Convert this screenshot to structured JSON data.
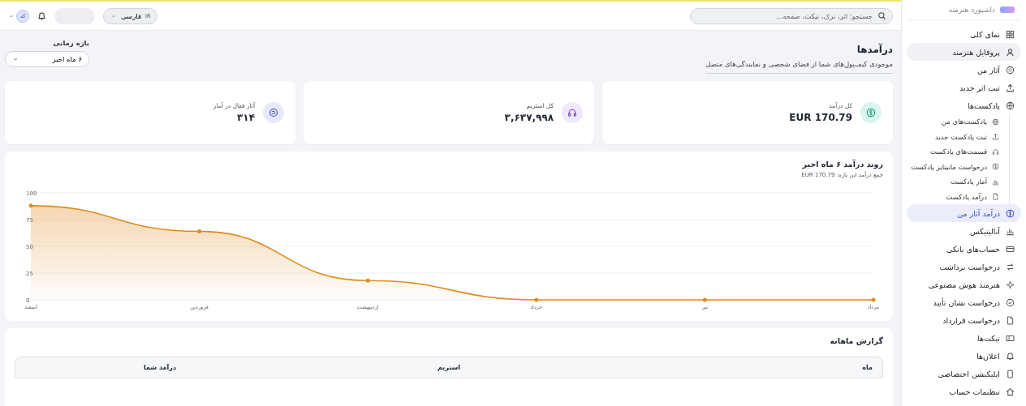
{
  "topbar": {
    "search": {
      "placeholder": "جستجو: اثر، ترک، تیکت، صفحه..."
    },
    "language": {
      "code": "IR",
      "label": "فارسی"
    },
    "avatar": {
      "initials": "که"
    }
  },
  "sidebar": {
    "brand": "داشبورد هنرمند",
    "items": [
      {
        "label": "نمای کلی",
        "selected": false,
        "highlighted": false
      },
      {
        "label": "پروفایل هنرمند",
        "selected": false,
        "highlighted": true
      },
      {
        "label": "آثار من",
        "selected": false,
        "highlighted": false
      },
      {
        "label": "ثبت اثر جدید",
        "selected": false,
        "highlighted": false
      },
      {
        "label": "پادکست‌ها",
        "selected": false,
        "highlighted": false,
        "children": [
          {
            "label": "پادکست‌های من",
            "selected": false
          },
          {
            "label": "ثبت پادکست جدید",
            "selected": false
          },
          {
            "label": "قسمت‌های پادکست",
            "selected": false
          },
          {
            "label": "درخواست مانیتایز پادکست",
            "selected": false
          },
          {
            "label": "آمار پادکست",
            "selected": false
          },
          {
            "label": "درآمد پادکست",
            "selected": false
          }
        ]
      },
      {
        "label": "درآمد آثار من",
        "selected": true,
        "highlighted": false
      },
      {
        "label": "آنالیتیکس",
        "selected": false,
        "highlighted": false
      },
      {
        "label": "حساب‌های بانکی",
        "selected": false,
        "highlighted": false
      },
      {
        "label": "درخواست برداشت",
        "selected": false,
        "highlighted": false
      },
      {
        "label": "هنرمند هوش مصنوعی",
        "selected": false,
        "highlighted": false
      },
      {
        "label": "درخواست نشان تأیید",
        "selected": false,
        "highlighted": false
      },
      {
        "label": "درخواست قرارداد",
        "selected": false,
        "highlighted": false
      },
      {
        "label": "تیکت‌ها",
        "selected": false,
        "highlighted": false
      },
      {
        "label": "اعلان‌ها",
        "selected": false,
        "highlighted": false
      },
      {
        "label": "اپلیکیشن اختصاصی",
        "selected": false,
        "highlighted": false
      },
      {
        "label": "تنظیمات حساب",
        "selected": false,
        "highlighted": false
      }
    ]
  },
  "header": {
    "title": "درآمدها",
    "subtitle": "موجودی کیف‌پول‌های شما از فضای شخصی و نمایندگی‌های متصل",
    "period": {
      "label": "بازه زمانی",
      "value": "۶ ماه اخیر"
    }
  },
  "stats": [
    {
      "label": "کل درآمد",
      "value": "EUR 170.79",
      "color": "#d9f5ee"
    },
    {
      "label": "کل استریم",
      "value": "۳,۶۳۷,۹۹۸",
      "color": "#efe8fb"
    },
    {
      "label": "آثار فعال در آمار",
      "value": "۳۱۴",
      "color": "#e6e9fb"
    }
  ],
  "trend": {
    "title": "روند درآمد ۶ ماه اخیر",
    "subtitle": "جمع درآمد این بازه: 170.79 EUR",
    "chart_data": {
      "type": "area",
      "categories": [
        "اسفند",
        "فروردین",
        "اردیبهشت",
        "خرداد",
        "تیر",
        "مرداد"
      ],
      "series": [
        {
          "color": "#e08a1e",
          "values": [
            88,
            64,
            18,
            0,
            0,
            0
          ]
        }
      ],
      "grid": true,
      "ylim": [
        0,
        100
      ],
      "yticks": [
        0,
        25,
        50,
        75,
        100
      ]
    }
  },
  "report": {
    "title": "گزارش ماهانه",
    "columns": [
      "ماه",
      "استریم",
      "درآمد شما"
    ]
  }
}
